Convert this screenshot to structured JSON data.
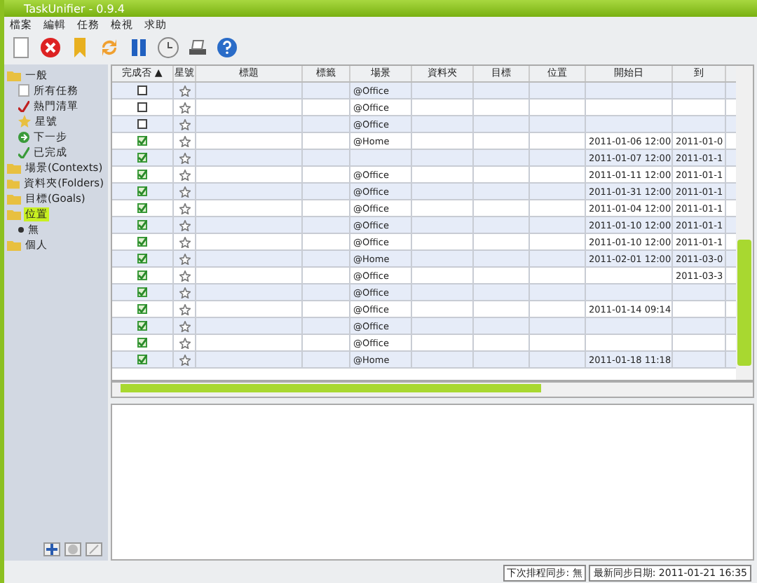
{
  "window": {
    "title": "TaskUnifier - 0.9.4"
  },
  "menu": [
    "檔案",
    "編輯",
    "任務",
    "檢視",
    "求助"
  ],
  "sidebar": {
    "items": [
      {
        "label": "一般",
        "selected": false,
        "children": [
          {
            "label": "所有任務",
            "kind": "page"
          },
          {
            "label": "熱門清單",
            "kind": "hot"
          },
          {
            "label": "星號",
            "kind": "star"
          },
          {
            "label": "下一步",
            "kind": "next"
          },
          {
            "label": "已完成",
            "kind": "done"
          }
        ]
      },
      {
        "label": "場景(Contexts)",
        "selected": false
      },
      {
        "label": "資料夾(Folders)",
        "selected": false
      },
      {
        "label": "目標(Goals)",
        "selected": false
      },
      {
        "label": "位置",
        "selected": true,
        "children": [
          {
            "label": "無",
            "kind": "none"
          }
        ]
      },
      {
        "label": "個人",
        "selected": false
      }
    ]
  },
  "table": {
    "columns": [
      "完成否 ▲",
      "星號",
      "標題",
      "標籤",
      "場景",
      "資料夾",
      "目標",
      "位置",
      "開始日",
      "到"
    ],
    "rows": [
      {
        "completed": false,
        "context": "@Office",
        "start": "",
        "due": ""
      },
      {
        "completed": false,
        "context": "@Office",
        "start": "",
        "due": ""
      },
      {
        "completed": false,
        "context": "@Office",
        "start": "",
        "due": ""
      },
      {
        "completed": true,
        "context": "@Home",
        "start": "2011-01-06 12:00",
        "due": "2011-01-0"
      },
      {
        "completed": true,
        "context": "",
        "start": "2011-01-07 12:00",
        "due": "2011-01-1"
      },
      {
        "completed": true,
        "context": "@Office",
        "start": "2011-01-11 12:00",
        "due": "2011-01-1"
      },
      {
        "completed": true,
        "context": "@Office",
        "start": "2011-01-31 12:00",
        "due": "2011-01-1"
      },
      {
        "completed": true,
        "context": "@Office",
        "start": "2011-01-04 12:00",
        "due": "2011-01-1"
      },
      {
        "completed": true,
        "context": "@Office",
        "start": "2011-01-10 12:00",
        "due": "2011-01-1"
      },
      {
        "completed": true,
        "context": "@Office",
        "start": "2011-01-10 12:00",
        "due": "2011-01-1"
      },
      {
        "completed": true,
        "context": "@Home",
        "start": "2011-02-01 12:00",
        "due": "2011-03-0"
      },
      {
        "completed": true,
        "context": "@Office",
        "start": "",
        "due": "2011-03-3"
      },
      {
        "completed": true,
        "context": "@Office",
        "start": "",
        "due": ""
      },
      {
        "completed": true,
        "context": "@Office",
        "start": "2011-01-14 09:14",
        "due": ""
      },
      {
        "completed": true,
        "context": "@Office",
        "start": "",
        "due": ""
      },
      {
        "completed": true,
        "context": "@Office",
        "start": "",
        "due": ""
      },
      {
        "completed": true,
        "context": "@Home",
        "start": "2011-01-18 11:18",
        "due": ""
      }
    ]
  },
  "status_bar": [
    "下次排程同步: 無",
    "最新同步日期: 2011-01-21 16:35"
  ]
}
